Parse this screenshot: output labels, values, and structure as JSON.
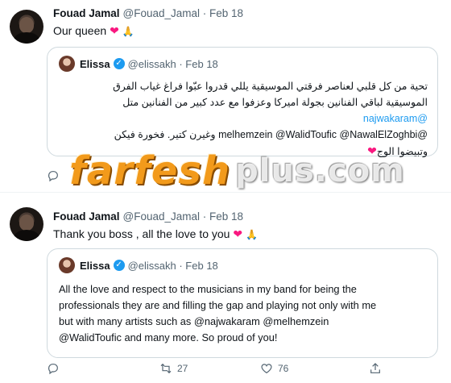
{
  "tweets": [
    {
      "author_name": "Fouad Jamal",
      "handle_date": "@Fouad_Jamal · Feb 18",
      "text": "Our queen",
      "quote": {
        "author_name": "Elissa",
        "handle_date": "@elissakh · Feb 18",
        "lines": [
          "تحية من كل قلبي لعناصر فرقتي الموسيقية يللي قدروا عبّوا فراغ غياب الفرق",
          "الموسيقية لباقي الفنانين بجولة اميركا وعزفوا مع عدد كبير من الفنانين متل",
          "@najwakaram",
          "@melhemzein @WalidToufic @NawalElZoghbi وغيرن كتير. فخورة فيكن",
          "وتبيضوا الوج"
        ]
      },
      "actions": {
        "reply": "",
        "retweet": "",
        "like": "",
        "views": ""
      }
    },
    {
      "author_name": "Fouad Jamal",
      "handle_date": "@Fouad_Jamal · Feb 18",
      "text": "Thank you boss , all the love to you",
      "quote": {
        "author_name": "Elissa",
        "handle_date": "@elissakh · Feb 18",
        "lines": [
          "All the love and respect to the musicians in my band for being the",
          "professionals they are and filling the gap and playing not only with me",
          "but with many artists such as @najwakaram @melhemzein",
          "@WalidToufic and many more. So proud of you!"
        ]
      },
      "actions": {
        "reply": "",
        "retweet": "27",
        "like": "76",
        "views": ""
      }
    }
  ],
  "watermark": {
    "main": "farfesh",
    "suffix": "plus.com"
  },
  "colors": {
    "accent": "#1d9bf0",
    "heart": "#f91880",
    "muted": "#536471",
    "watermark": "#f29a1b"
  },
  "icons": [
    "reply-icon",
    "retweet-icon",
    "like-icon",
    "share-icon",
    "verified-icon",
    "heart-emoji",
    "praying-hands-emoji"
  ]
}
